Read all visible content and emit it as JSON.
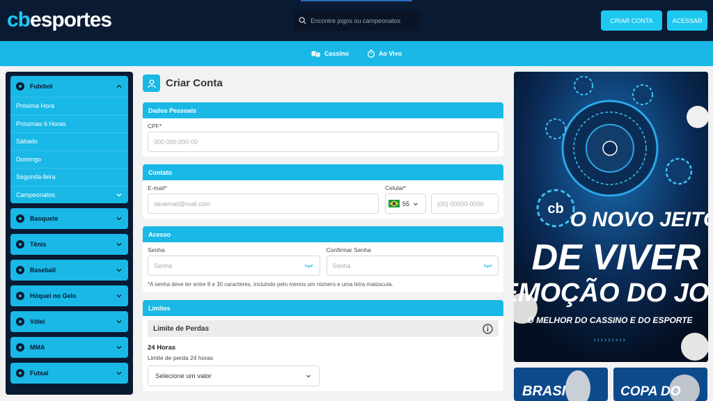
{
  "header": {
    "logo_prefix": "cb",
    "logo_suffix": "esportes",
    "search_placeholder": "Encontre jogos ou campeonatos",
    "create_account": "CRIAR CONTA",
    "login": "ACESSAR"
  },
  "nav": {
    "casino": "Cassino",
    "live": "Ao Vivo"
  },
  "sidebar": {
    "football": {
      "label": "Futebol",
      "items": [
        "Próxima Hora",
        "Próximas 6 Horas",
        "Sábado",
        "Domingo",
        "Segunda-feira",
        "Campeonatos"
      ]
    },
    "sports": [
      "Basquete",
      "Tênis",
      "Baseball",
      "Hóquei no Gelo",
      "Vôlei",
      "MMA",
      "Futsal"
    ]
  },
  "form": {
    "title": "Criar Conta",
    "personal": {
      "header": "Dados Pessoais",
      "cpf_label": "CPF*",
      "cpf_placeholder": "000.000.000-00"
    },
    "contact": {
      "header": "Contato",
      "email_label": "E-mail*",
      "email_placeholder": "seuemail@mail.com",
      "phone_label": "Celular*",
      "country_code": "55",
      "phone_placeholder": "(00) 00000-0000"
    },
    "access": {
      "header": "Acesso",
      "password_label": "Senha",
      "password_placeholder": "Senha",
      "confirm_label": "Confirmar Senha",
      "confirm_placeholder": "Senha",
      "note": "*A senha deve ter entre 8 e 30 caracteres, incluindo pelo menos um número e uma letra maiúscula."
    },
    "limits": {
      "header": "Limites",
      "loss_limit": "Limite de Perdas",
      "hours": "24 Horas",
      "hours_label": "Limite de perda 24 horas",
      "select_placeholder": "Selecione um valor"
    }
  },
  "banner": {
    "line1": "O NOVO JEITO",
    "line2": "DE VIVER A",
    "line3": "EMOÇÃO DO JOGO",
    "tagline": "O MELHOR DO CASSINO E DO ESPORTE",
    "chip_text": "cb",
    "small1": "BRASI",
    "small2": "COPA DO"
  },
  "colors": {
    "accent": "#19b8e6",
    "dark": "#0b1a33",
    "banner_yellow": "#f5c518"
  }
}
